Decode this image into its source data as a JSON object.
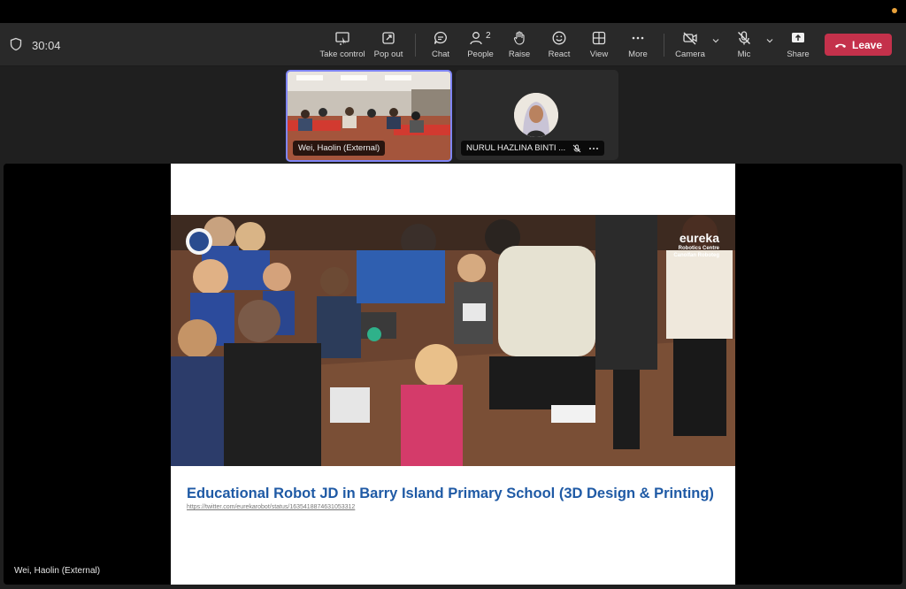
{
  "meeting": {
    "timer": "30:04"
  },
  "toolbar": {
    "take_control": "Take control",
    "pop_out": "Pop out",
    "chat": "Chat",
    "people": "People",
    "people_count": "2",
    "raise": "Raise",
    "react": "React",
    "view": "View",
    "more": "More",
    "camera": "Camera",
    "mic": "Mic",
    "share": "Share",
    "leave": "Leave"
  },
  "participants": [
    {
      "name": "Wei, Haolin (External)"
    },
    {
      "name": "NURUL HAZLINA BINTI ..."
    }
  ],
  "slide": {
    "title": "Educational Robot JD in Barry Island Primary School (3D Design & Printing)",
    "link": "https://twitter.com/eurekarobot/status/1635418874631053312",
    "logo_main": "eureka",
    "logo_line1": "Robotics Centre",
    "logo_line2": "Canolfan Roboteg"
  },
  "presenter_label": "Wei, Haolin (External)",
  "colors": {
    "leave": "#c4314b",
    "active_tile": "#7f85f5",
    "title": "#1f5aa5"
  }
}
